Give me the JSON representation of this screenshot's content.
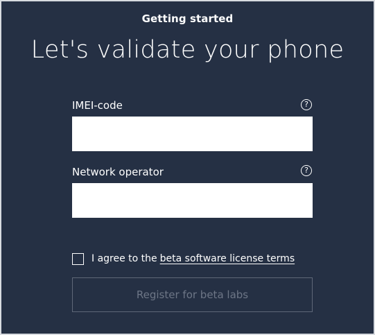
{
  "header": {
    "subtitle": "Getting started",
    "title": "Let's validate your phone"
  },
  "form": {
    "imei": {
      "label": "IMEI-code",
      "value": "",
      "help_icon": "question-circle-icon",
      "help_glyph": "?"
    },
    "operator": {
      "label": "Network operator",
      "value": "",
      "help_icon": "question-circle-icon",
      "help_glyph": "?"
    },
    "agreement": {
      "checked": false,
      "text": "I agree to the",
      "link_text": "beta software license terms"
    },
    "submit": {
      "label": "Register for beta labs",
      "enabled": false
    }
  },
  "colors": {
    "background": "#253044",
    "text": "#ffffff",
    "disabled_text": "#6d7686",
    "disabled_border": "#5f6878"
  }
}
